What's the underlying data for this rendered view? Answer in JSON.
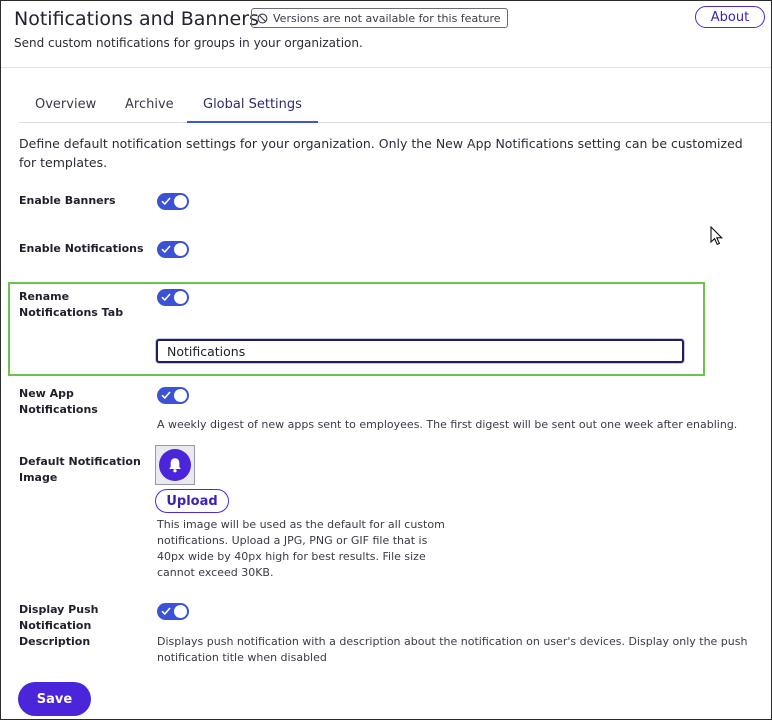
{
  "header": {
    "title": "Notifications and Banners",
    "version_badge": "Versions are not available for this feature",
    "about_label": "About",
    "subtitle": "Send custom notifications for groups in your organization."
  },
  "tabs": [
    {
      "label": "Overview",
      "active": false
    },
    {
      "label": "Archive",
      "active": false
    },
    {
      "label": "Global Settings",
      "active": true
    }
  ],
  "description": "Define default notification settings for your organization. Only the New App Notifications setting can be customized for templates.",
  "settings": {
    "enable_banners": {
      "label": "Enable Banners",
      "enabled": true
    },
    "enable_notifications": {
      "label": "Enable Notifications",
      "enabled": true
    },
    "rename_tab": {
      "label": "Rename Notifications Tab",
      "enabled": true,
      "input_value": "Notifications"
    },
    "new_app": {
      "label": "New App Notifications",
      "enabled": true,
      "help": "A weekly digest of new apps sent to employees. The first digest will be sent out one week after enabling."
    },
    "default_image": {
      "label": "Default Notification Image",
      "upload_label": "Upload",
      "help": "This image will be used as the default for all custom notifications. Upload a JPG, PNG or GIF file that is 40px wide by 40px high for best results. File size cannot exceed 30KB."
    },
    "push_description": {
      "label": "Display Push Notification Description",
      "enabled": true,
      "help": "Displays push notification with a description about the notification on user's devices. Display only the push notification title when disabled"
    }
  },
  "save_label": "Save",
  "colors": {
    "accent": "#4a25d9",
    "toggle_on": "#3952d6",
    "highlight": "#6cc24a"
  },
  "icons": {
    "badge": "no-entry-icon",
    "image": "bell-icon",
    "toggle": "check-icon",
    "cursor": "mouse-pointer-icon"
  }
}
